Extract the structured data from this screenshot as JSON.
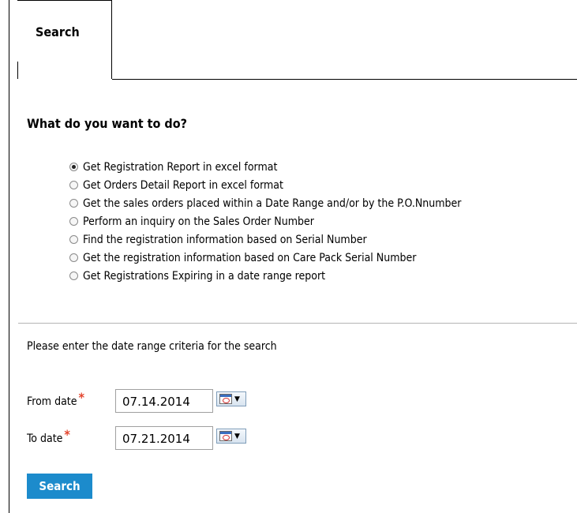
{
  "tabs": [
    {
      "label": "Search"
    }
  ],
  "question": "What do you want to do?",
  "options": [
    {
      "label": "Get Registration Report in excel format",
      "checked": true
    },
    {
      "label": "Get Orders Detail Report in excel format",
      "checked": false
    },
    {
      "label": "Get the sales orders placed within a Date Range and/or by the P.O.Nnumber",
      "checked": false
    },
    {
      "label": "Perform an inquiry on the Sales Order Number",
      "checked": false
    },
    {
      "label": "Find the registration information based on Serial Number",
      "checked": false
    },
    {
      "label": "Get the registration information based on Care Pack Serial Number",
      "checked": false
    },
    {
      "label": "Get Registrations Expiring in a date range report",
      "checked": false
    }
  ],
  "criteria_text": "Please enter the date range criteria for the search",
  "fields": {
    "from": {
      "label": "From date",
      "required_mark": "*",
      "value": "07.14.2014"
    },
    "to": {
      "label": "To date",
      "required_mark": "*",
      "value": "07.21.2014"
    }
  },
  "search_button_label": "Search",
  "colors": {
    "accent": "#1c8bcc",
    "required": "#e3432c"
  },
  "icons": {
    "calendar": "calendar-icon",
    "dropdown": "chevron-down-icon"
  }
}
